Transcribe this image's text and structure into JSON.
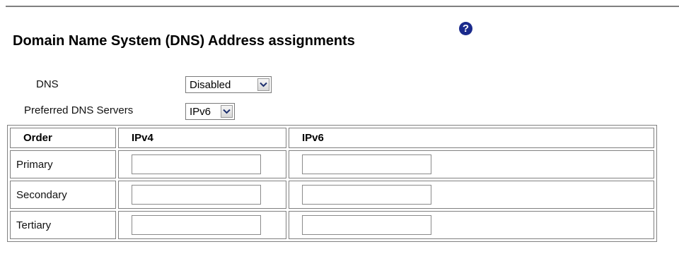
{
  "title": "Domain Name System (DNS) Address assignments",
  "help_icon": "help-icon",
  "fields": {
    "dns": {
      "label": "DNS",
      "value": "Disabled"
    },
    "preferred": {
      "label": "Preferred DNS Servers",
      "value": "IPv6"
    }
  },
  "table": {
    "headers": [
      "Order",
      "IPv4",
      "IPv6"
    ],
    "rows": [
      {
        "label": "Primary",
        "ipv4": "",
        "ipv6": ""
      },
      {
        "label": "Secondary",
        "ipv4": "",
        "ipv6": ""
      },
      {
        "label": "Tertiary",
        "ipv4": "",
        "ipv6": ""
      }
    ]
  }
}
